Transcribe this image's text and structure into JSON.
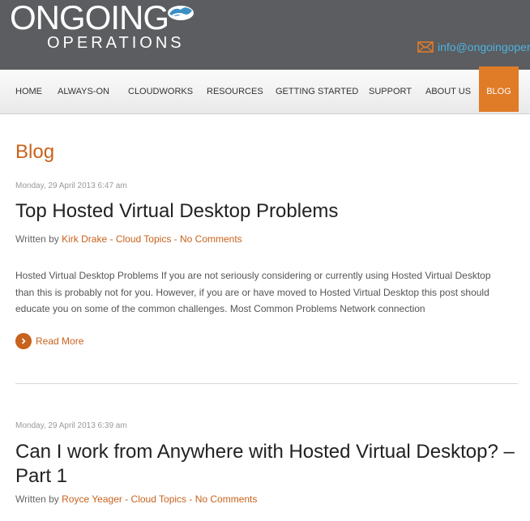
{
  "logo": {
    "main": "ONGOING",
    "sub": "OPERATIONS"
  },
  "header": {
    "email": "info@ongoingoper"
  },
  "nav": {
    "items": [
      {
        "label": "HOME"
      },
      {
        "label": "ALWAYS-ON"
      },
      {
        "label": "CLOUDWORKS"
      },
      {
        "label": "RESOURCES"
      },
      {
        "label": "GETTING STARTED"
      },
      {
        "label": "SUPPORT"
      },
      {
        "label": "ABOUT US"
      },
      {
        "label": "BLOG"
      }
    ]
  },
  "page": {
    "title": "Blog"
  },
  "posts": [
    {
      "date": "Monday, 29 April 2013 6:47 am",
      "title": "Top Hosted Virtual Desktop Problems",
      "written_by": "Written by",
      "author": "Kirk Drake",
      "sep1": " - ",
      "category": "Cloud Topics",
      "sep2": " - ",
      "comments": "No Comments",
      "excerpt": "Hosted Virtual Desktop Problems If you are not seriously considering or currently using Hosted Virtual Desktop than this is probably not for you. However, if you are or have moved to Hosted Virtual Desktop this post should educate you on some of the common challenges. Most Common Problems Network connection",
      "read_more": "Read More"
    },
    {
      "date": "Monday, 29 April 2013 6:39 am",
      "title": "Can I work from Anywhere with Hosted Virtual Desktop? – Part 1",
      "written_by": "Written by",
      "author": "Royce Yeager",
      "sep1": " - ",
      "category": "Cloud Topics",
      "sep2": " - ",
      "comments": "No Comments"
    }
  ],
  "colors": {
    "accent": "#c8621c",
    "nav_active": "#e07b27",
    "header_bg": "#5b5d60",
    "email": "#4fb2df"
  }
}
